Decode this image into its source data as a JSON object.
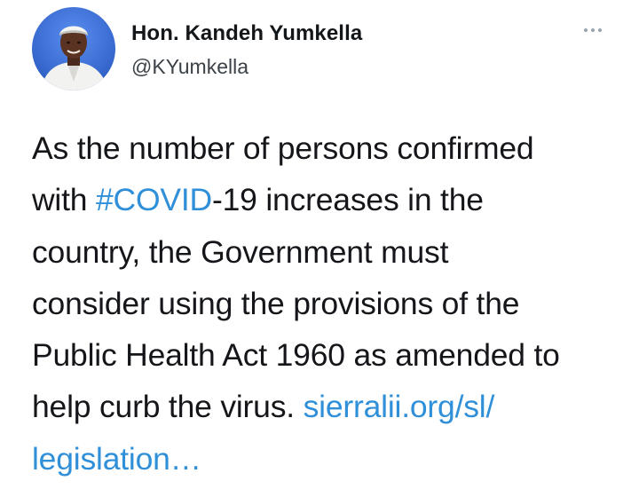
{
  "author": {
    "name": "Hon. Kandeh Yumkella",
    "handle": "@KYumkella",
    "avatar_icon": "profile-photo"
  },
  "more_icon": "more-dots-icon",
  "tweet": {
    "line1": "As the number of persons confirmed",
    "line2_before": "with ",
    "hashtag": "#COVID",
    "line2_after": "-19 increases in the",
    "line3": "country, the Government must",
    "line4": "consider using the provisions of the",
    "line5": "Public Health Act 1960 as amended to",
    "line6_before": "help curb the virus. ",
    "link_part1": "sierralii.org/sl/",
    "link_part2": "legislation…"
  },
  "colors": {
    "text": "#141619",
    "link": "#2f8fd8",
    "handle": "#3c4247",
    "avatar_bg": "#3a6fd0"
  }
}
